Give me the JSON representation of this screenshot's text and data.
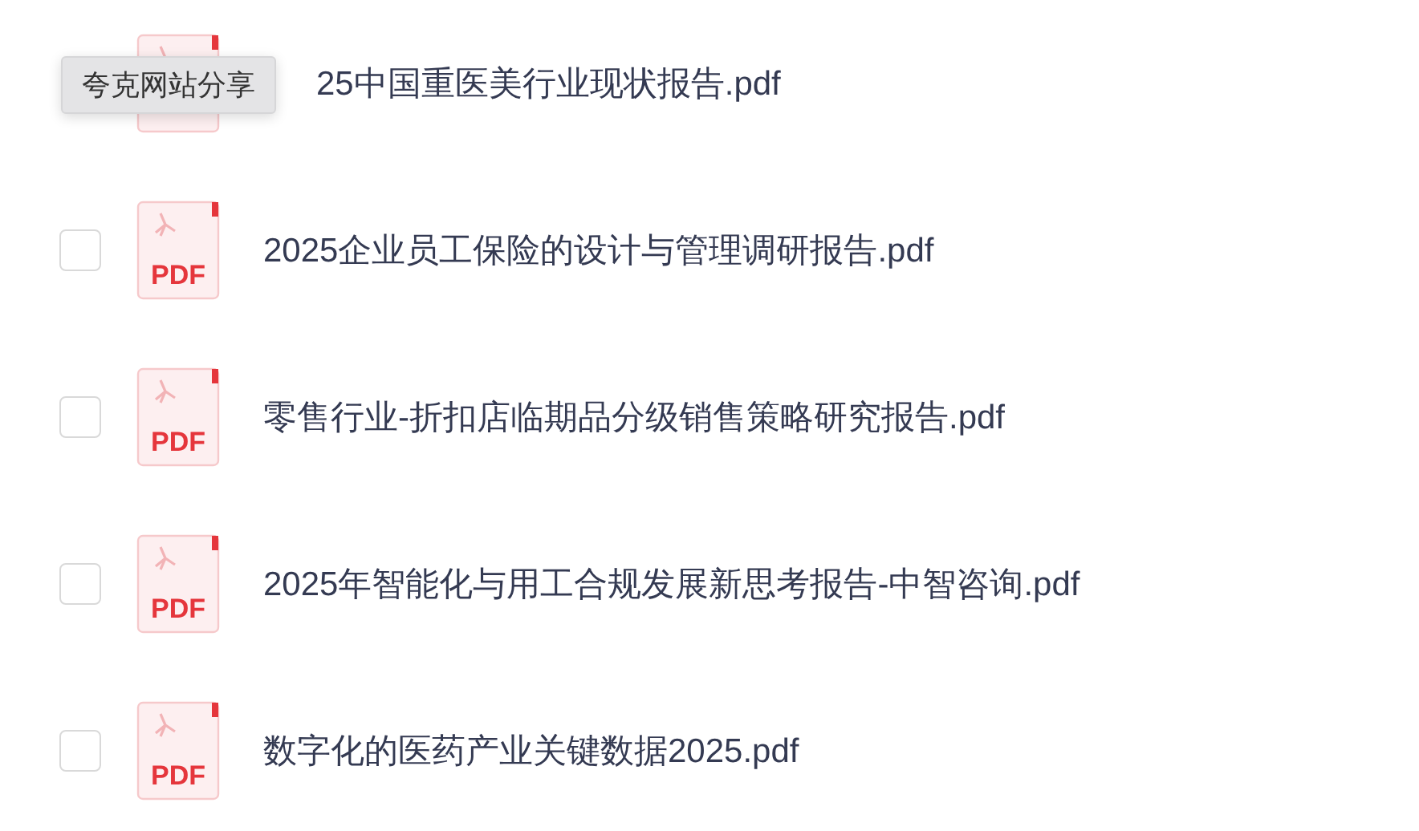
{
  "tooltip": {
    "text": "夸克网站分享"
  },
  "files": [
    {
      "name": "25中国重医美行业现状报告.pdf"
    },
    {
      "name": "2025企业员工保险的设计与管理调研报告.pdf",
      "checked": false,
      "icon_label": "PDF"
    },
    {
      "name": "零售行业-折扣店临期品分级销售策略研究报告.pdf",
      "checked": false,
      "icon_label": "PDF"
    },
    {
      "name": "2025年智能化与用工合规发展新思考报告-中智咨询.pdf",
      "checked": false,
      "icon_label": "PDF"
    },
    {
      "name": "数字化的医药产业关键数据2025.pdf",
      "checked": false,
      "icon_label": "PDF"
    }
  ]
}
